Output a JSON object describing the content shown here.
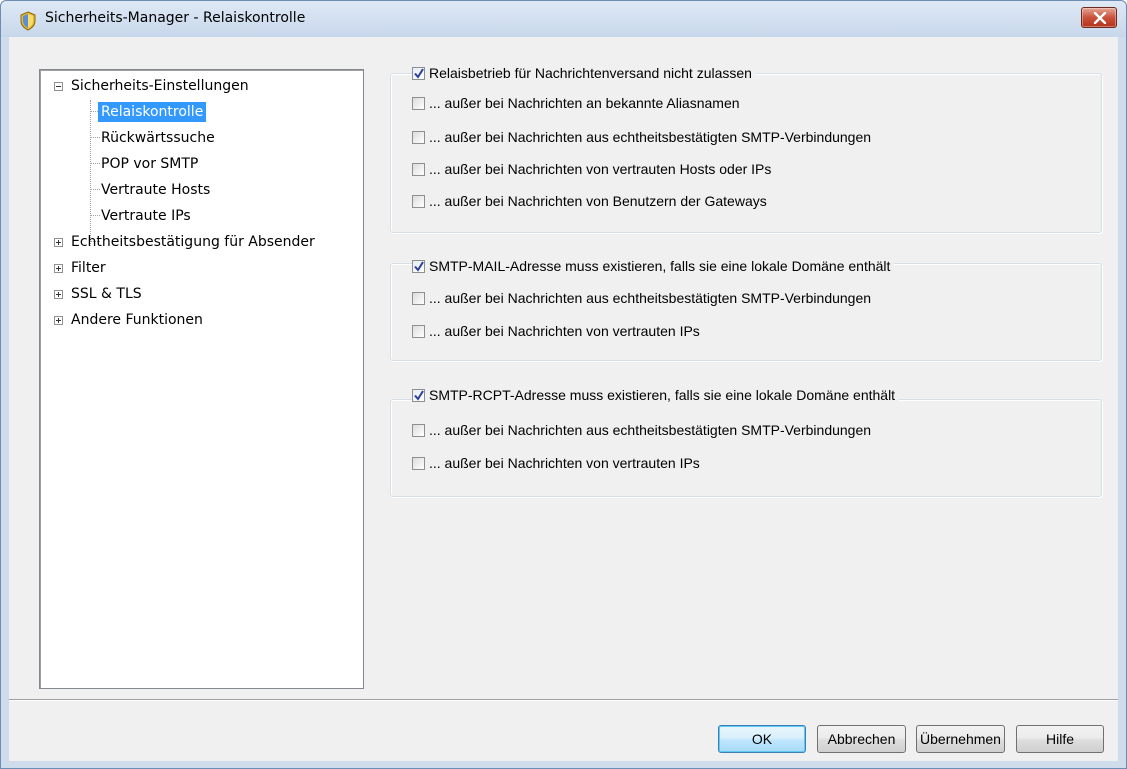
{
  "window": {
    "title": "Sicherheits-Manager - Relaiskontrolle",
    "title_icon": "shield-icon",
    "close_icon": "close-icon",
    "colors": {
      "selection": "#3399ff",
      "close": "#c9513b",
      "default_button": "#bee6fd"
    }
  },
  "tree": {
    "items": [
      {
        "label": "Sicherheits-Einstellungen",
        "expander": "minus",
        "selected": false
      },
      {
        "label": "Relaiskontrolle",
        "selected": true
      },
      {
        "label": "Rückwärtssuche",
        "selected": false
      },
      {
        "label": "POP vor SMTP",
        "selected": false
      },
      {
        "label": "Vertraute Hosts",
        "selected": false
      },
      {
        "label": "Vertraute IPs",
        "selected": false
      },
      {
        "label": "Echtheitsbestätigung für Absender",
        "expander": "plus",
        "selected": false
      },
      {
        "label": "Filter",
        "expander": "plus",
        "selected": false
      },
      {
        "label": "SSL & TLS",
        "expander": "plus",
        "selected": false
      },
      {
        "label": "Andere Funktionen",
        "expander": "plus",
        "selected": false
      }
    ]
  },
  "groups": [
    {
      "header": {
        "label": "Relaisbetrieb für Nachrichtenversand nicht zulassen",
        "checked": true
      },
      "options": [
        {
          "label": "... außer bei Nachrichten an bekannte Aliasnamen",
          "checked": false
        },
        {
          "label": "... außer bei Nachrichten aus echtheitsbestätigten SMTP-Verbindungen",
          "checked": false
        },
        {
          "label": "... außer bei Nachrichten von vertrauten Hosts oder IPs",
          "checked": false
        },
        {
          "label": "... außer bei Nachrichten von Benutzern der Gateways",
          "checked": false
        }
      ]
    },
    {
      "header": {
        "label": "SMTP-MAIL-Adresse muss existieren, falls sie eine lokale Domäne enthält",
        "checked": true
      },
      "options": [
        {
          "label": "... außer bei Nachrichten aus echtheitsbestätigten SMTP-Verbindungen",
          "checked": false
        },
        {
          "label": "... außer bei Nachrichten von vertrauten IPs",
          "checked": false
        }
      ]
    },
    {
      "header": {
        "label": "SMTP-RCPT-Adresse muss existieren, falls sie eine lokale Domäne enthält",
        "checked": true
      },
      "options": [
        {
          "label": "... außer bei Nachrichten aus echtheitsbestätigten SMTP-Verbindungen",
          "checked": false
        },
        {
          "label": "... außer bei Nachrichten von vertrauten IPs",
          "checked": false
        }
      ]
    }
  ],
  "buttons": {
    "ok": "OK",
    "cancel": "Abbrechen",
    "apply": "Übernehmen",
    "help": "Hilfe"
  }
}
